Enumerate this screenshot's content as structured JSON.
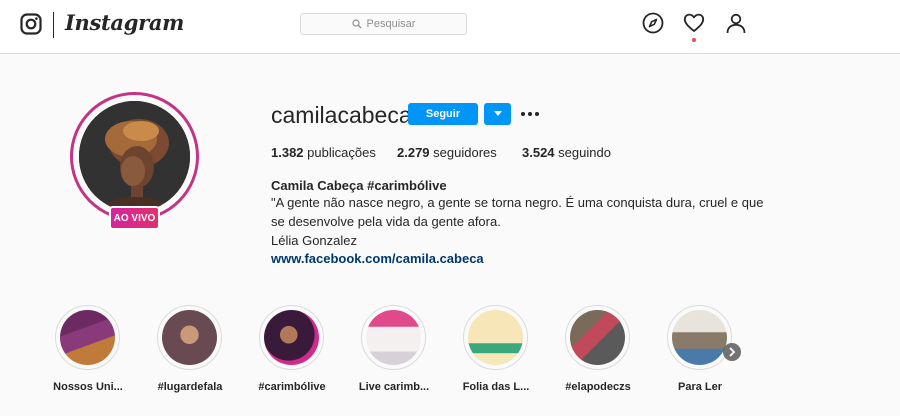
{
  "header": {
    "brand": "Instagram",
    "search_placeholder": "Pesquisar",
    "icons": [
      "instagram-logo-icon",
      "search-icon",
      "compass-icon",
      "heart-icon",
      "profile-icon"
    ],
    "has_notification": true
  },
  "profile": {
    "username": "camilacabeca",
    "follow_label": "Seguir",
    "live_label": "AO VIVO",
    "stats": {
      "posts_value": "1.382",
      "posts_label": "publicações",
      "followers_value": "2.279",
      "followers_label": "seguidores",
      "following_value": "3.524",
      "following_label": "seguindo"
    },
    "full_name": "Camila Cabeça #carimbólive",
    "bio_lines": [
      "\"A gente não nasce negro, a gente se torna negro. É uma conquista dura, cruel e que",
      "se desenvolve pela vida da gente afora.",
      "Lélia Gonzalez"
    ],
    "link": "www.facebook.com/camila.cabeca"
  },
  "highlights": [
    {
      "label": "Nossos Uni..."
    },
    {
      "label": "#lugardefala"
    },
    {
      "label": "#carimbólive"
    },
    {
      "label": "Live carimb..."
    },
    {
      "label": "Folia das L..."
    },
    {
      "label": "#elapodeczs"
    },
    {
      "label": "Para Ler"
    }
  ],
  "colors": {
    "accent_blue": "#0095f6",
    "live_gradient_start": "#d6249f",
    "live_gradient_end": "#e1306c",
    "link": "#00376b",
    "notification": "#ed4956"
  }
}
